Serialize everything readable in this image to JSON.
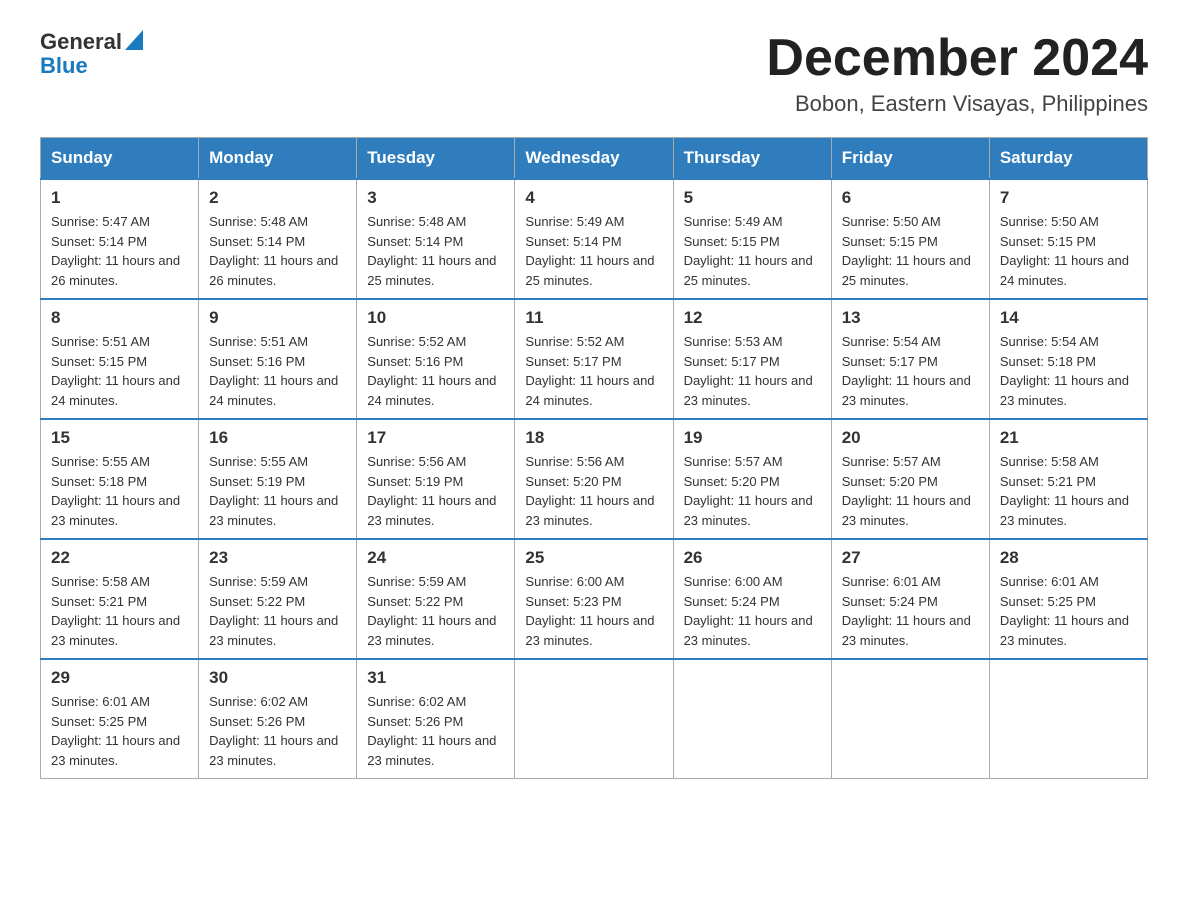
{
  "logo": {
    "text_general": "General",
    "text_blue": "Blue",
    "aria": "GeneralBlue logo"
  },
  "title": {
    "month_year": "December 2024",
    "location": "Bobon, Eastern Visayas, Philippines"
  },
  "days_header": [
    "Sunday",
    "Monday",
    "Tuesday",
    "Wednesday",
    "Thursday",
    "Friday",
    "Saturday"
  ],
  "weeks": [
    [
      {
        "day": "1",
        "sunrise": "Sunrise: 5:47 AM",
        "sunset": "Sunset: 5:14 PM",
        "daylight": "Daylight: 11 hours and 26 minutes."
      },
      {
        "day": "2",
        "sunrise": "Sunrise: 5:48 AM",
        "sunset": "Sunset: 5:14 PM",
        "daylight": "Daylight: 11 hours and 26 minutes."
      },
      {
        "day": "3",
        "sunrise": "Sunrise: 5:48 AM",
        "sunset": "Sunset: 5:14 PM",
        "daylight": "Daylight: 11 hours and 25 minutes."
      },
      {
        "day": "4",
        "sunrise": "Sunrise: 5:49 AM",
        "sunset": "Sunset: 5:14 PM",
        "daylight": "Daylight: 11 hours and 25 minutes."
      },
      {
        "day": "5",
        "sunrise": "Sunrise: 5:49 AM",
        "sunset": "Sunset: 5:15 PM",
        "daylight": "Daylight: 11 hours and 25 minutes."
      },
      {
        "day": "6",
        "sunrise": "Sunrise: 5:50 AM",
        "sunset": "Sunset: 5:15 PM",
        "daylight": "Daylight: 11 hours and 25 minutes."
      },
      {
        "day": "7",
        "sunrise": "Sunrise: 5:50 AM",
        "sunset": "Sunset: 5:15 PM",
        "daylight": "Daylight: 11 hours and 24 minutes."
      }
    ],
    [
      {
        "day": "8",
        "sunrise": "Sunrise: 5:51 AM",
        "sunset": "Sunset: 5:15 PM",
        "daylight": "Daylight: 11 hours and 24 minutes."
      },
      {
        "day": "9",
        "sunrise": "Sunrise: 5:51 AM",
        "sunset": "Sunset: 5:16 PM",
        "daylight": "Daylight: 11 hours and 24 minutes."
      },
      {
        "day": "10",
        "sunrise": "Sunrise: 5:52 AM",
        "sunset": "Sunset: 5:16 PM",
        "daylight": "Daylight: 11 hours and 24 minutes."
      },
      {
        "day": "11",
        "sunrise": "Sunrise: 5:52 AM",
        "sunset": "Sunset: 5:17 PM",
        "daylight": "Daylight: 11 hours and 24 minutes."
      },
      {
        "day": "12",
        "sunrise": "Sunrise: 5:53 AM",
        "sunset": "Sunset: 5:17 PM",
        "daylight": "Daylight: 11 hours and 23 minutes."
      },
      {
        "day": "13",
        "sunrise": "Sunrise: 5:54 AM",
        "sunset": "Sunset: 5:17 PM",
        "daylight": "Daylight: 11 hours and 23 minutes."
      },
      {
        "day": "14",
        "sunrise": "Sunrise: 5:54 AM",
        "sunset": "Sunset: 5:18 PM",
        "daylight": "Daylight: 11 hours and 23 minutes."
      }
    ],
    [
      {
        "day": "15",
        "sunrise": "Sunrise: 5:55 AM",
        "sunset": "Sunset: 5:18 PM",
        "daylight": "Daylight: 11 hours and 23 minutes."
      },
      {
        "day": "16",
        "sunrise": "Sunrise: 5:55 AM",
        "sunset": "Sunset: 5:19 PM",
        "daylight": "Daylight: 11 hours and 23 minutes."
      },
      {
        "day": "17",
        "sunrise": "Sunrise: 5:56 AM",
        "sunset": "Sunset: 5:19 PM",
        "daylight": "Daylight: 11 hours and 23 minutes."
      },
      {
        "day": "18",
        "sunrise": "Sunrise: 5:56 AM",
        "sunset": "Sunset: 5:20 PM",
        "daylight": "Daylight: 11 hours and 23 minutes."
      },
      {
        "day": "19",
        "sunrise": "Sunrise: 5:57 AM",
        "sunset": "Sunset: 5:20 PM",
        "daylight": "Daylight: 11 hours and 23 minutes."
      },
      {
        "day": "20",
        "sunrise": "Sunrise: 5:57 AM",
        "sunset": "Sunset: 5:20 PM",
        "daylight": "Daylight: 11 hours and 23 minutes."
      },
      {
        "day": "21",
        "sunrise": "Sunrise: 5:58 AM",
        "sunset": "Sunset: 5:21 PM",
        "daylight": "Daylight: 11 hours and 23 minutes."
      }
    ],
    [
      {
        "day": "22",
        "sunrise": "Sunrise: 5:58 AM",
        "sunset": "Sunset: 5:21 PM",
        "daylight": "Daylight: 11 hours and 23 minutes."
      },
      {
        "day": "23",
        "sunrise": "Sunrise: 5:59 AM",
        "sunset": "Sunset: 5:22 PM",
        "daylight": "Daylight: 11 hours and 23 minutes."
      },
      {
        "day": "24",
        "sunrise": "Sunrise: 5:59 AM",
        "sunset": "Sunset: 5:22 PM",
        "daylight": "Daylight: 11 hours and 23 minutes."
      },
      {
        "day": "25",
        "sunrise": "Sunrise: 6:00 AM",
        "sunset": "Sunset: 5:23 PM",
        "daylight": "Daylight: 11 hours and 23 minutes."
      },
      {
        "day": "26",
        "sunrise": "Sunrise: 6:00 AM",
        "sunset": "Sunset: 5:24 PM",
        "daylight": "Daylight: 11 hours and 23 minutes."
      },
      {
        "day": "27",
        "sunrise": "Sunrise: 6:01 AM",
        "sunset": "Sunset: 5:24 PM",
        "daylight": "Daylight: 11 hours and 23 minutes."
      },
      {
        "day": "28",
        "sunrise": "Sunrise: 6:01 AM",
        "sunset": "Sunset: 5:25 PM",
        "daylight": "Daylight: 11 hours and 23 minutes."
      }
    ],
    [
      {
        "day": "29",
        "sunrise": "Sunrise: 6:01 AM",
        "sunset": "Sunset: 5:25 PM",
        "daylight": "Daylight: 11 hours and 23 minutes."
      },
      {
        "day": "30",
        "sunrise": "Sunrise: 6:02 AM",
        "sunset": "Sunset: 5:26 PM",
        "daylight": "Daylight: 11 hours and 23 minutes."
      },
      {
        "day": "31",
        "sunrise": "Sunrise: 6:02 AM",
        "sunset": "Sunset: 5:26 PM",
        "daylight": "Daylight: 11 hours and 23 minutes."
      },
      null,
      null,
      null,
      null
    ]
  ]
}
